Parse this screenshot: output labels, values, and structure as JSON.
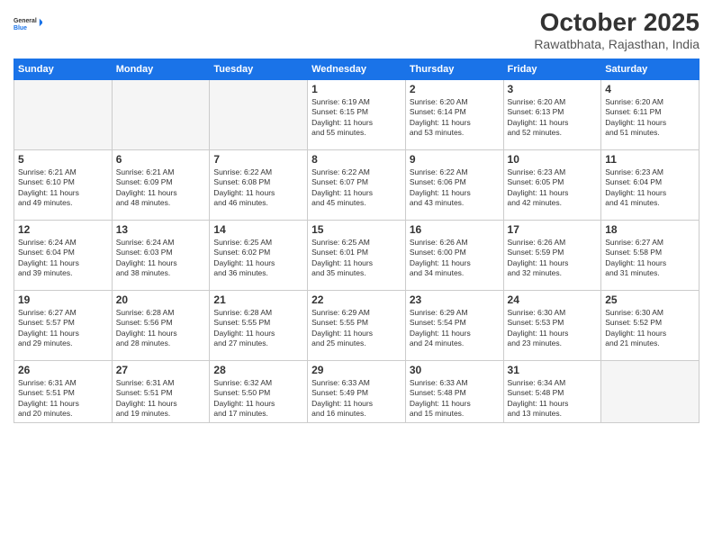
{
  "logo": {
    "line1": "General",
    "line2": "Blue"
  },
  "title": "October 2025",
  "subtitle": "Rawatbhata, Rajasthan, India",
  "weekdays": [
    "Sunday",
    "Monday",
    "Tuesday",
    "Wednesday",
    "Thursday",
    "Friday",
    "Saturday"
  ],
  "weeks": [
    [
      {
        "day": "",
        "info": ""
      },
      {
        "day": "",
        "info": ""
      },
      {
        "day": "",
        "info": ""
      },
      {
        "day": "1",
        "info": "Sunrise: 6:19 AM\nSunset: 6:15 PM\nDaylight: 11 hours\nand 55 minutes."
      },
      {
        "day": "2",
        "info": "Sunrise: 6:20 AM\nSunset: 6:14 PM\nDaylight: 11 hours\nand 53 minutes."
      },
      {
        "day": "3",
        "info": "Sunrise: 6:20 AM\nSunset: 6:13 PM\nDaylight: 11 hours\nand 52 minutes."
      },
      {
        "day": "4",
        "info": "Sunrise: 6:20 AM\nSunset: 6:11 PM\nDaylight: 11 hours\nand 51 minutes."
      }
    ],
    [
      {
        "day": "5",
        "info": "Sunrise: 6:21 AM\nSunset: 6:10 PM\nDaylight: 11 hours\nand 49 minutes."
      },
      {
        "day": "6",
        "info": "Sunrise: 6:21 AM\nSunset: 6:09 PM\nDaylight: 11 hours\nand 48 minutes."
      },
      {
        "day": "7",
        "info": "Sunrise: 6:22 AM\nSunset: 6:08 PM\nDaylight: 11 hours\nand 46 minutes."
      },
      {
        "day": "8",
        "info": "Sunrise: 6:22 AM\nSunset: 6:07 PM\nDaylight: 11 hours\nand 45 minutes."
      },
      {
        "day": "9",
        "info": "Sunrise: 6:22 AM\nSunset: 6:06 PM\nDaylight: 11 hours\nand 43 minutes."
      },
      {
        "day": "10",
        "info": "Sunrise: 6:23 AM\nSunset: 6:05 PM\nDaylight: 11 hours\nand 42 minutes."
      },
      {
        "day": "11",
        "info": "Sunrise: 6:23 AM\nSunset: 6:04 PM\nDaylight: 11 hours\nand 41 minutes."
      }
    ],
    [
      {
        "day": "12",
        "info": "Sunrise: 6:24 AM\nSunset: 6:04 PM\nDaylight: 11 hours\nand 39 minutes."
      },
      {
        "day": "13",
        "info": "Sunrise: 6:24 AM\nSunset: 6:03 PM\nDaylight: 11 hours\nand 38 minutes."
      },
      {
        "day": "14",
        "info": "Sunrise: 6:25 AM\nSunset: 6:02 PM\nDaylight: 11 hours\nand 36 minutes."
      },
      {
        "day": "15",
        "info": "Sunrise: 6:25 AM\nSunset: 6:01 PM\nDaylight: 11 hours\nand 35 minutes."
      },
      {
        "day": "16",
        "info": "Sunrise: 6:26 AM\nSunset: 6:00 PM\nDaylight: 11 hours\nand 34 minutes."
      },
      {
        "day": "17",
        "info": "Sunrise: 6:26 AM\nSunset: 5:59 PM\nDaylight: 11 hours\nand 32 minutes."
      },
      {
        "day": "18",
        "info": "Sunrise: 6:27 AM\nSunset: 5:58 PM\nDaylight: 11 hours\nand 31 minutes."
      }
    ],
    [
      {
        "day": "19",
        "info": "Sunrise: 6:27 AM\nSunset: 5:57 PM\nDaylight: 11 hours\nand 29 minutes."
      },
      {
        "day": "20",
        "info": "Sunrise: 6:28 AM\nSunset: 5:56 PM\nDaylight: 11 hours\nand 28 minutes."
      },
      {
        "day": "21",
        "info": "Sunrise: 6:28 AM\nSunset: 5:55 PM\nDaylight: 11 hours\nand 27 minutes."
      },
      {
        "day": "22",
        "info": "Sunrise: 6:29 AM\nSunset: 5:55 PM\nDaylight: 11 hours\nand 25 minutes."
      },
      {
        "day": "23",
        "info": "Sunrise: 6:29 AM\nSunset: 5:54 PM\nDaylight: 11 hours\nand 24 minutes."
      },
      {
        "day": "24",
        "info": "Sunrise: 6:30 AM\nSunset: 5:53 PM\nDaylight: 11 hours\nand 23 minutes."
      },
      {
        "day": "25",
        "info": "Sunrise: 6:30 AM\nSunset: 5:52 PM\nDaylight: 11 hours\nand 21 minutes."
      }
    ],
    [
      {
        "day": "26",
        "info": "Sunrise: 6:31 AM\nSunset: 5:51 PM\nDaylight: 11 hours\nand 20 minutes."
      },
      {
        "day": "27",
        "info": "Sunrise: 6:31 AM\nSunset: 5:51 PM\nDaylight: 11 hours\nand 19 minutes."
      },
      {
        "day": "28",
        "info": "Sunrise: 6:32 AM\nSunset: 5:50 PM\nDaylight: 11 hours\nand 17 minutes."
      },
      {
        "day": "29",
        "info": "Sunrise: 6:33 AM\nSunset: 5:49 PM\nDaylight: 11 hours\nand 16 minutes."
      },
      {
        "day": "30",
        "info": "Sunrise: 6:33 AM\nSunset: 5:48 PM\nDaylight: 11 hours\nand 15 minutes."
      },
      {
        "day": "31",
        "info": "Sunrise: 6:34 AM\nSunset: 5:48 PM\nDaylight: 11 hours\nand 13 minutes."
      },
      {
        "day": "",
        "info": ""
      }
    ]
  ]
}
